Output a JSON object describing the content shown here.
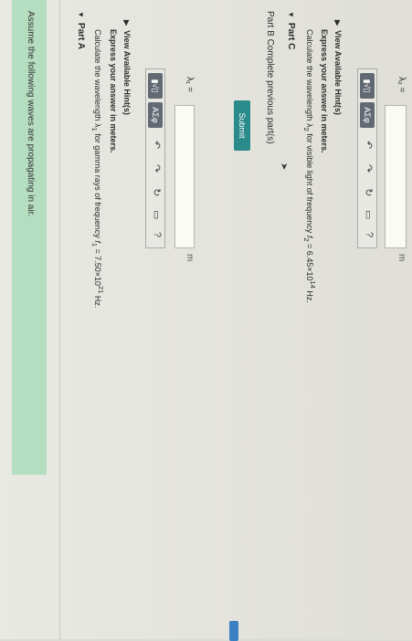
{
  "banner": {
    "text": "Assume the following waves are propagating in air."
  },
  "part_a": {
    "title": "Part A",
    "instruction_pre": "Calculate the wavelength λ",
    "instruction_sub": "1",
    "instruction_mid": " for gamma rays of frequency ",
    "instruction_var": "f",
    "instruction_var_sub": "1",
    "instruction_post": " = 7.50×10",
    "instruction_exp": "21",
    "instruction_unit": " Hz.",
    "express": "Express your answer in meters.",
    "hint_link": "View Available Hint(s)",
    "var_label": "λ₁ =",
    "unit": "m",
    "submit": "Submit"
  },
  "part_b": {
    "title": "Part B",
    "status": "Complete previous part(s)"
  },
  "part_c": {
    "title": "Part C",
    "instruction_pre": "Calculate the wavelength λ",
    "instruction_sub": "2",
    "instruction_mid": " for visible light of frequency ",
    "instruction_var": "f",
    "instruction_var_sub": "2",
    "instruction_post": " = 6.45×10",
    "instruction_exp": "14",
    "instruction_unit": " Hz.",
    "express": "Express your answer in meters.",
    "hint_link": "View Available Hint(s)",
    "var_label": "λ₂ =",
    "unit": "m"
  },
  "toolbar": {
    "template_label": "▮√▯",
    "greek_label": "ΑΣφ",
    "undo_icon": "↶",
    "redo_icon": "↷",
    "reset_icon": "↻",
    "keyboard_icon": "▭",
    "help_icon": "?"
  }
}
